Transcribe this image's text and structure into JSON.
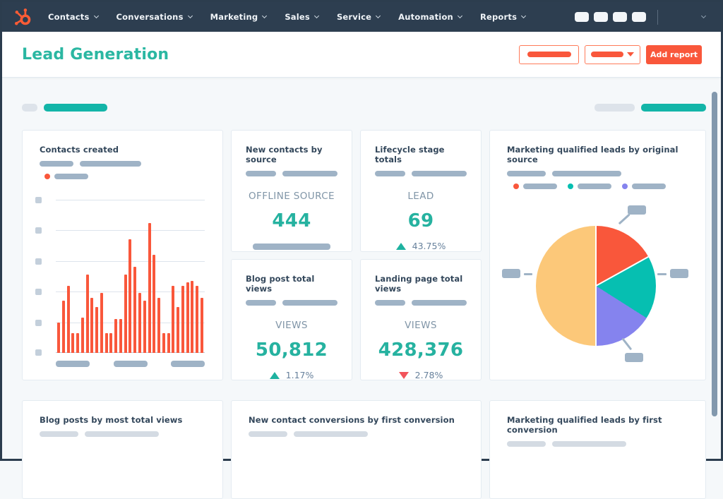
{
  "navbar": {
    "logo_icon": "hubspot-sprocket-logo",
    "items": [
      {
        "label": "Contacts"
      },
      {
        "label": "Conversations"
      },
      {
        "label": "Marketing"
      },
      {
        "label": "Sales"
      },
      {
        "label": "Service"
      },
      {
        "label": "Automation"
      },
      {
        "label": "Reports"
      }
    ]
  },
  "header": {
    "title": "Lead Generation",
    "add_report_label": "Add report"
  },
  "cards": {
    "contacts_created": {
      "title": "Contacts created"
    },
    "new_contacts_by_source": {
      "title": "New contacts by source",
      "metric_label": "OFFLINE SOURCE",
      "value": "444"
    },
    "lifecycle_stage_totals": {
      "title": "Lifecycle stage totals",
      "metric_label": "LEAD",
      "value": "69",
      "delta": "43.75%",
      "delta_direction": "up"
    },
    "mql_original_source": {
      "title": "Marketing qualified leads by original source"
    },
    "blog_post_total_views": {
      "title": "Blog post total views",
      "metric_label": "VIEWS",
      "value": "50,812",
      "delta": "1.17%",
      "delta_direction": "up"
    },
    "landing_page_total_views": {
      "title": "Landing page total views",
      "metric_label": "VIEWS",
      "value": "428,376",
      "delta": "2.78%",
      "delta_direction": "down"
    },
    "blog_posts_most_views": {
      "title": "Blog posts by most total views"
    },
    "new_contact_conversions": {
      "title": "New contact conversions by first conversion"
    },
    "mql_first_conversion": {
      "title": "Marketing qualified leads by first conversion"
    }
  },
  "chart_data": [
    {
      "type": "bar",
      "title": "Contacts created",
      "bar_color": "#f9573b",
      "ylim": [
        0,
        5
      ],
      "gridlines": 5,
      "x_axis_labels": "redacted-placeholders (3 pills)",
      "y_axis_labels": "redacted-placeholders (6 squares)",
      "legend": "1 series, orange dot, label redacted",
      "values": [
        1.0,
        1.7,
        2.2,
        0.65,
        0.65,
        1.15,
        2.55,
        1.8,
        1.5,
        1.95,
        0.65,
        0.65,
        1.1,
        1.1,
        2.55,
        3.7,
        2.8,
        1.95,
        1.7,
        4.25,
        3.2,
        1.8,
        0.65,
        0.65,
        2.2,
        1.5,
        2.2,
        2.3,
        2.35,
        2.2,
        1.8
      ]
    },
    {
      "type": "pie",
      "title": "Marketing qualified leads by original source",
      "legend": "3 dot items with redacted labels",
      "labels_redacted": true,
      "slices": [
        {
          "name": "slice-orange",
          "pct": 17,
          "color": "#f9573b"
        },
        {
          "name": "slice-teal",
          "pct": 17,
          "color": "#06bfb1"
        },
        {
          "name": "slice-purple",
          "pct": 16,
          "color": "#8583ee"
        },
        {
          "name": "slice-yellow",
          "pct": 50,
          "color": "#fcc879"
        }
      ]
    }
  ],
  "colors": {
    "navy": "#2d3e50",
    "teal_accent": "#26b2a0",
    "orange_accent": "#f9573b",
    "delta_up": "#1eb2a0",
    "delta_down": "#f2545b",
    "placeholder_gray": "#9fb3c6"
  }
}
